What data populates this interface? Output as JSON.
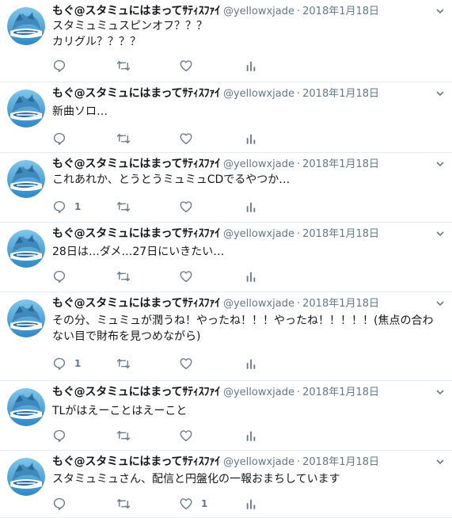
{
  "user": {
    "name": "もぐ@スタミュにはまってｻﾃｨｽﾌｧｲ",
    "handle": "@yellowxjade"
  },
  "tweets": [
    {
      "date": "2018年1月18日",
      "text": "スタミュミュスピンオフ？？？\nカリグル？？？？",
      "reply_count": "",
      "like_count": ""
    },
    {
      "date": "2018年1月18日",
      "text": "新曲ソロ…",
      "reply_count": "",
      "like_count": ""
    },
    {
      "date": "2018年1月18日",
      "text": "これあれか、とうとうミュミュCDでるやつか…",
      "reply_count": "1",
      "like_count": ""
    },
    {
      "date": "2018年1月18日",
      "text": "28日は…ダメ…27日にいきたい…",
      "reply_count": "",
      "like_count": ""
    },
    {
      "date": "2018年1月18日",
      "text": "その分、ミュミュが潤うね！やったね！！！やったね！！！！！(焦点の合わない目で財布を見つめながら)",
      "reply_count": "1",
      "like_count": ""
    },
    {
      "date": "2018年1月18日",
      "text": "TLがはえーことはえーこと",
      "reply_count": "",
      "like_count": ""
    },
    {
      "date": "2018年1月18日",
      "text": "スタミュミュさん、配信と円盤化の一報おまちしています",
      "reply_count": "",
      "like_count": "1"
    }
  ],
  "colors": {
    "icon": "#657786",
    "border": "#e6ecf0",
    "text": "#14171a",
    "muted": "#657786"
  }
}
